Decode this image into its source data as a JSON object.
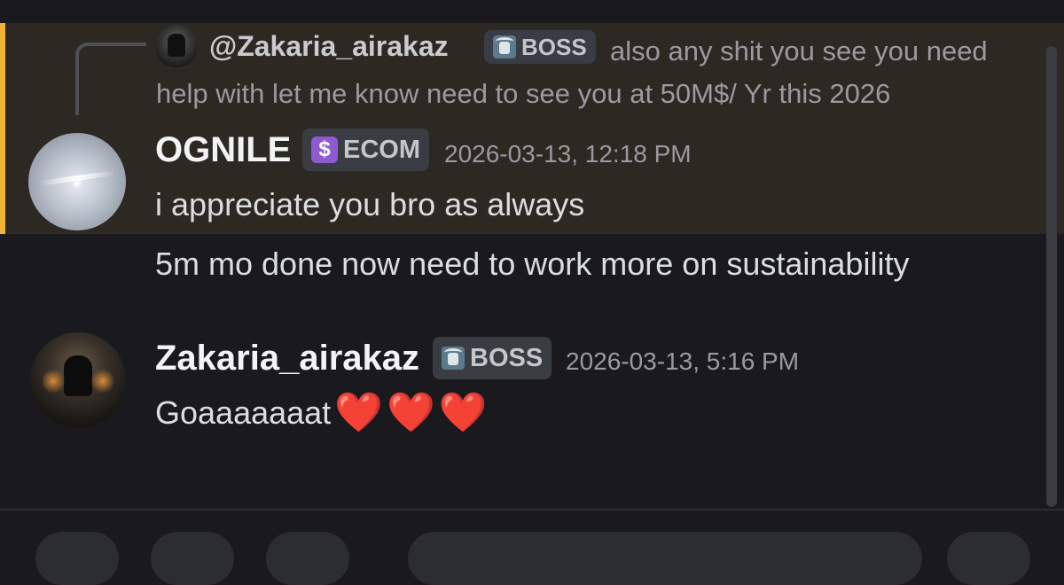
{
  "reply": {
    "author": "@Zakaria_airakaz",
    "role_tag": "BOSS",
    "text": "also any shit you see you need help with let me know need to see you at 50M$/ Yr this 2026"
  },
  "messages": [
    {
      "author": "OGNILE",
      "role_tag": "ECOM",
      "timestamp": "2026-03-13, 12:18 PM",
      "lines": [
        "i appreciate you bro as always",
        "5m mo done now need to work more on sustainability"
      ],
      "highlighted": true
    },
    {
      "author": "Zakaria_airakaz",
      "role_tag": "BOSS",
      "timestamp": "2026-03-13, 5:16 PM",
      "lines": [
        "Goaaaaaaat"
      ],
      "emojis": [
        "❤️",
        "❤️",
        "❤️"
      ]
    }
  ],
  "colors": {
    "background": "#1a1a1e",
    "mention_highlight": "#2c2822",
    "mention_bar": "#f0b232",
    "heart": "#e0202e"
  },
  "icons": {
    "boss_tag_icon": "goat-icon",
    "ecom_tag_icon": "ecom-icon"
  }
}
